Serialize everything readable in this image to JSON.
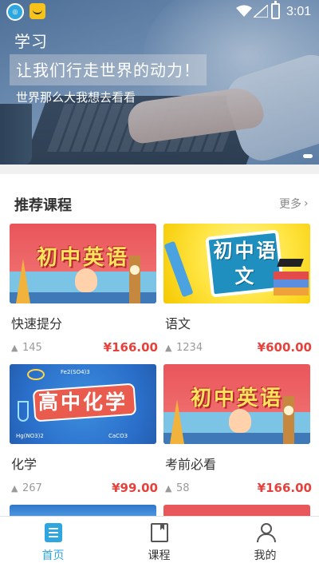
{
  "status_bar": {
    "time": "3:01",
    "icons": [
      "app-360-icon",
      "app-shop-icon",
      "wifi-icon",
      "signal-icon",
      "battery-charging-icon"
    ]
  },
  "hero": {
    "title": "学习",
    "slogan": "让我们行走世界的动力！",
    "subtitle": "世界那么大我想去看看",
    "indicator_count": 1
  },
  "section": {
    "title": "推荐课程",
    "more_label": "更多",
    "more_icon": "chevron-right-icon",
    "more_glyph": "›"
  },
  "courses": [
    {
      "name": "快速提分",
      "thumb_text": "初中英语",
      "count": "145",
      "price": "¥166.00",
      "count_glyph": "▲"
    },
    {
      "name": "语文",
      "thumb_text": "初中语文",
      "count": "1234",
      "price": "¥600.00",
      "count_glyph": "▲"
    },
    {
      "name": "化学",
      "thumb_text": "高中化学",
      "count": "267",
      "price": "¥99.00",
      "count_glyph": "▲",
      "formulas": [
        "Fe2(SO4)3",
        "Hg(NO3)2",
        "CaCO3"
      ]
    },
    {
      "name": "考前必看",
      "thumb_text": "初中英语",
      "count": "58",
      "price": "¥166.00",
      "count_glyph": "▲"
    }
  ],
  "colors": {
    "accent": "#2ea7e0",
    "price": "#e8413c",
    "text": "#333333",
    "muted": "#9a9a9a"
  },
  "tabbar": {
    "tabs": [
      {
        "label": "首页",
        "icon": "home-list-icon",
        "active": true
      },
      {
        "label": "课程",
        "icon": "book-bookmark-icon",
        "active": false
      },
      {
        "label": "我的",
        "icon": "user-icon",
        "active": false
      }
    ]
  }
}
